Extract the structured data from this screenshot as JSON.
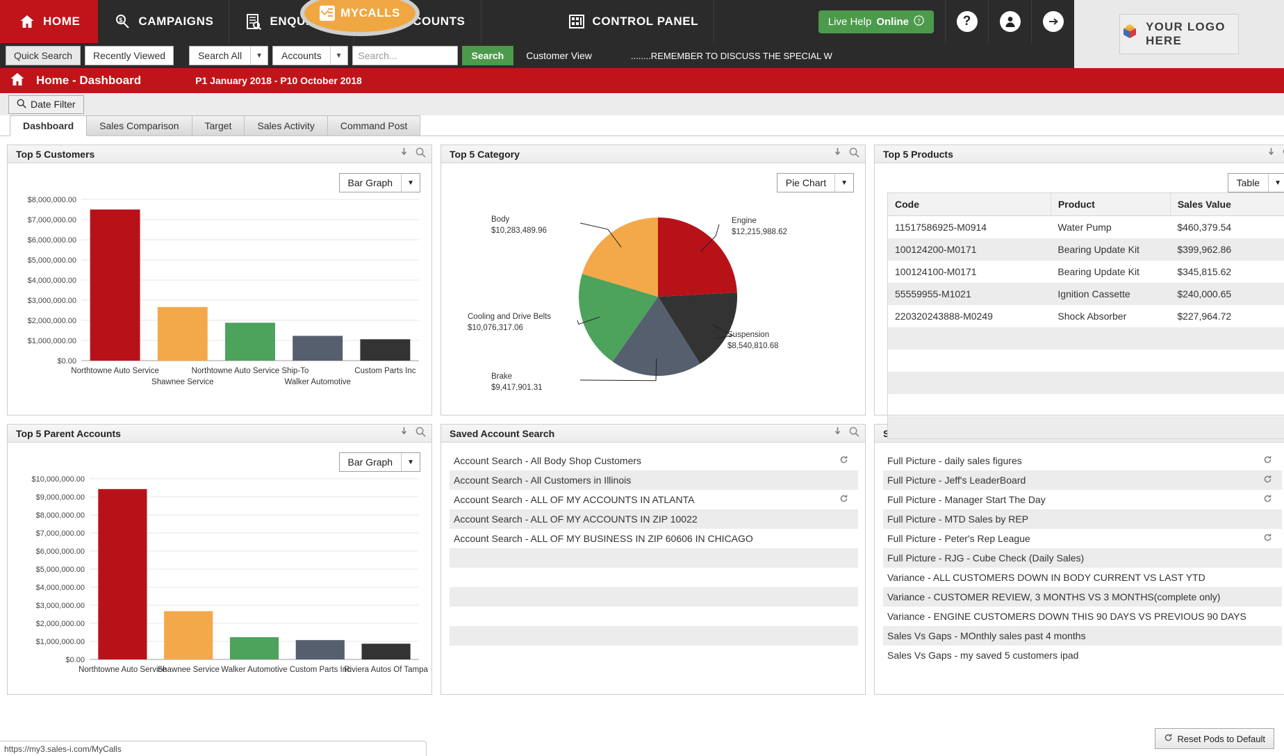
{
  "nav": {
    "items": [
      {
        "label": "HOME",
        "icon": "home-icon",
        "active": true
      },
      {
        "label": "CAMPAIGNS",
        "icon": "campaigns-icon",
        "active": false
      },
      {
        "label": "ENQUIRIES",
        "icon": "enquiries-icon",
        "active": false
      },
      {
        "label": "ACCOUNTS",
        "icon": "accounts-icon",
        "active": false
      },
      {
        "label": "CONTROL PANEL",
        "icon": "control-panel-icon",
        "active": false
      }
    ],
    "mycalls_label": "MYCALLS",
    "live_help_prefix": "Live Help ",
    "live_help_status": "Online",
    "help_icon": "?",
    "user_icon": "user-icon",
    "logout_icon": "logout-arrow-icon"
  },
  "logo": {
    "text": "YOUR LOGO HERE"
  },
  "search": {
    "quick_search": "Quick Search",
    "recently_viewed": "Recently Viewed",
    "scope_select": "Search All",
    "entity_select": "Accounts",
    "placeholder": "Search...",
    "search_button": "Search",
    "customer_view": "Customer View",
    "marquee": "........REMEMBER TO DISCUSS THE SPECIAL W"
  },
  "titlebar": {
    "title": "Home - Dashboard",
    "period": "P1 January 2018 - P10 October 2018"
  },
  "filter": {
    "date_filter": "Date Filter"
  },
  "tabs": [
    {
      "label": "Dashboard",
      "active": true
    },
    {
      "label": "Sales Comparison",
      "active": false
    },
    {
      "label": "Target",
      "active": false
    },
    {
      "label": "Sales Activity",
      "active": false
    },
    {
      "label": "Command Post",
      "active": false
    }
  ],
  "pods": {
    "top_customers": {
      "title": "Top 5 Customers",
      "view_select": "Bar Graph"
    },
    "top_category": {
      "title": "Top 5 Category",
      "view_select": "Pie Chart"
    },
    "top_products": {
      "title": "Top 5 Products",
      "view_select": "Table"
    },
    "top_parents": {
      "title": "Top 5 Parent Accounts",
      "view_select": "Bar Graph"
    },
    "saved_account_search": {
      "title": "Saved Account Search"
    },
    "saved_enquiries": {
      "title": "Saved Enquiries"
    }
  },
  "products_table": {
    "columns": [
      "Code",
      "Product",
      "Sales Value"
    ],
    "rows": [
      [
        "11517586925-M0914",
        "Water Pump",
        "$460,379.54"
      ],
      [
        "100124200-M0171",
        "Bearing Update Kit",
        "$399,962.86"
      ],
      [
        "100124100-M0171",
        "Bearing Update Kit",
        "$345,815.62"
      ],
      [
        "55559955-M1021",
        "Ignition Cassette",
        "$240,000.65"
      ],
      [
        "220320243888-M0249",
        "Shock Absorber",
        "$227,964.72"
      ]
    ],
    "empty_rows": 5
  },
  "saved_account_search": {
    "items": [
      {
        "label": "Account Search - All Body Shop Customers",
        "has_refresh": true
      },
      {
        "label": "Account Search - All Customers in Illinois",
        "has_refresh": false
      },
      {
        "label": "Account Search - ALL OF MY ACCOUNTS IN ATLANTA",
        "has_refresh": true
      },
      {
        "label": "Account Search - ALL OF MY ACCOUNTS IN ZIP 10022",
        "has_refresh": false
      },
      {
        "label": "Account Search - ALL OF MY BUSINESS IN ZIP 60606 IN CHICAGO",
        "has_refresh": false
      }
    ],
    "empty_rows": 5
  },
  "saved_enquiries": {
    "items": [
      {
        "label": "Full Picture - daily sales figures",
        "has_refresh": true
      },
      {
        "label": "Full Picture - Jeff's LeaderBoard",
        "has_refresh": true
      },
      {
        "label": "Full Picture - Manager Start The Day",
        "has_refresh": true
      },
      {
        "label": "Full Picture - MTD Sales by REP",
        "has_refresh": false
      },
      {
        "label": "Full Picture - Peter's Rep League",
        "has_refresh": true
      },
      {
        "label": "Full Picture - RJG - Cube Check (Daily Sales)",
        "has_refresh": false
      },
      {
        "label": "Variance - ALL CUSTOMERS DOWN IN BODY CURRENT VS LAST YTD",
        "has_refresh": false
      },
      {
        "label": "Variance - CUSTOMER REVIEW, 3 MONTHS VS 3 MONTHS(complete only)",
        "has_refresh": false
      },
      {
        "label": "Variance - ENGINE CUSTOMERS DOWN THIS 90 DAYS VS PREVIOUS 90 DAYS",
        "has_refresh": false
      },
      {
        "label": "Sales Vs Gaps - MOnthly sales past 4 months",
        "has_refresh": false
      },
      {
        "label": "Sales Vs Gaps - my saved 5 customers ipad",
        "has_refresh": false
      }
    ]
  },
  "footer": {
    "reset_button": "Reset Pods to Default",
    "status_url": "https://my3.sales-i.com/MyCalls"
  },
  "palette": {
    "red": "#b81219",
    "orange": "#f3a949",
    "green": "#4da25c",
    "slate": "#555f6e",
    "charcoal": "#333333",
    "brand_red": "#c1141a",
    "nav_dark": "#2b2b2b",
    "green_btn": "#4c9a4c",
    "mycalls_orange": "#f0a742"
  },
  "chart_data": [
    {
      "type": "bar",
      "title": "Top 5 Customers",
      "xlabel": "",
      "ylabel": "",
      "categories": [
        "Northtowne Auto Service",
        "Shawnee Service",
        "Northtowne Auto Service Ship-To",
        "Walker Automotive",
        "Custom Parts Inc"
      ],
      "values": [
        7500000,
        2660000,
        1880000,
        1230000,
        1060000
      ],
      "colors": [
        "#b81219",
        "#f3a949",
        "#4da25c",
        "#555f6e",
        "#333333"
      ],
      "ylim": [
        0,
        8000000
      ],
      "yticks": [
        0,
        1000000,
        2000000,
        3000000,
        4000000,
        5000000,
        6000000,
        7000000,
        8000000
      ],
      "ytick_labels": [
        "$0.00",
        "$1,000,000.00",
        "$2,000,000.00",
        "$3,000,000.00",
        "$4,000,000.00",
        "$5,000,000.00",
        "$6,000,000.00",
        "$7,000,000.00",
        "$8,000,000.00"
      ],
      "grid": true,
      "legend": "none"
    },
    {
      "type": "pie",
      "title": "Top 5 Category",
      "labels": [
        "Engine",
        "Suspension",
        "Brake",
        "Cooling and Drive Belts",
        "Body"
      ],
      "value_labels": [
        "$12,215,988.62",
        "$8,540,810.68",
        "$9,417,901.31",
        "$10,076,317.06",
        "$10,283,489.96"
      ],
      "values": [
        12215988.62,
        8540810.68,
        9417901.31,
        10076317.06,
        10283489.96
      ],
      "colors": [
        "#b81219",
        "#333333",
        "#555f6e",
        "#4da25c",
        "#f3a949"
      ],
      "legend": "callout-labels"
    },
    {
      "type": "table",
      "title": "Top 5 Products",
      "columns": [
        "Code",
        "Product",
        "Sales Value"
      ],
      "rows": [
        [
          "11517586925-M0914",
          "Water Pump",
          "$460,379.54"
        ],
        [
          "100124200-M0171",
          "Bearing Update Kit",
          "$399,962.86"
        ],
        [
          "100124100-M0171",
          "Bearing Update Kit",
          "$345,815.62"
        ],
        [
          "55559955-M1021",
          "Ignition Cassette",
          "$240,000.65"
        ],
        [
          "220320243888-M0249",
          "Shock Absorber",
          "$227,964.72"
        ]
      ]
    },
    {
      "type": "bar",
      "title": "Top 5 Parent Accounts",
      "xlabel": "",
      "ylabel": "",
      "categories": [
        "Northtowne Auto Service",
        "Shawnee Service",
        "Walker Automotive",
        "Custom Parts Inc",
        "Riviera Autos Of Tampa"
      ],
      "values": [
        9430000,
        2670000,
        1230000,
        1070000,
        870000
      ],
      "colors": [
        "#b81219",
        "#f3a949",
        "#4da25c",
        "#555f6e",
        "#333333"
      ],
      "ylim": [
        0,
        10000000
      ],
      "yticks": [
        0,
        1000000,
        2000000,
        3000000,
        4000000,
        5000000,
        6000000,
        7000000,
        8000000,
        9000000,
        10000000
      ],
      "ytick_labels": [
        "$0.00",
        "$1,000,000.00",
        "$2,000,000.00",
        "$3,000,000.00",
        "$4,000,000.00",
        "$5,000,000.00",
        "$6,000,000.00",
        "$7,000,000.00",
        "$8,000,000.00",
        "$9,000,000.00",
        "$10,000,000.00"
      ],
      "grid": true,
      "legend": "none"
    }
  ]
}
